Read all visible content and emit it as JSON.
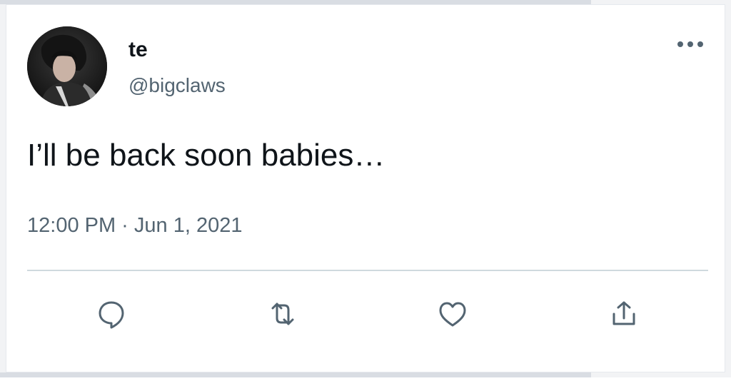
{
  "tweet": {
    "author_name": "te",
    "author_handle": "@bigclaws",
    "text": "I’ll be back soon babies…",
    "timestamp": "12:00 PM · Jun 1, 2021"
  },
  "icons": {
    "more": "more-horizontal-icon",
    "reply": "speech-bubble-icon",
    "retweet": "retweet-arrows-icon",
    "like": "heart-icon",
    "share": "share-upload-icon"
  },
  "colors": {
    "text_primary": "#0f1419",
    "text_secondary": "#536471",
    "divider": "#cfd9de",
    "card_background": "#ffffff"
  }
}
